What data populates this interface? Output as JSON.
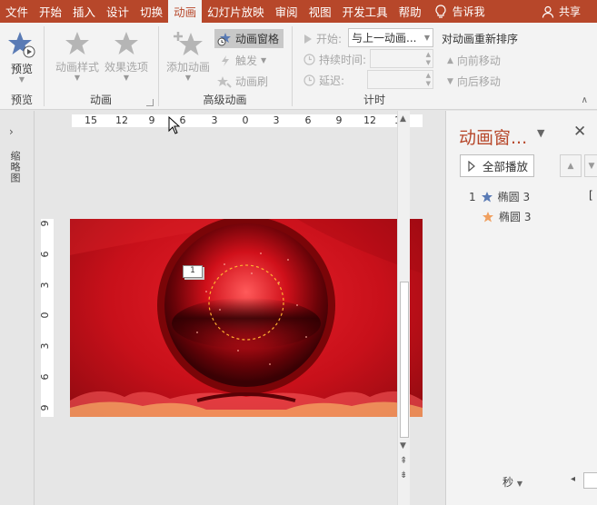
{
  "tabs": [
    "文件",
    "开始",
    "插入",
    "设计",
    "切换",
    "动画",
    "幻灯片放映",
    "审阅",
    "视图",
    "开发工具",
    "帮助"
  ],
  "active_tab_index": 5,
  "tell_me": "告诉我",
  "share": "共享",
  "ribbon": {
    "preview_group": {
      "button": "预览",
      "label": "预览"
    },
    "animation_group": {
      "styles": "动画样式",
      "effects": "效果选项",
      "label": "动画"
    },
    "advanced_group": {
      "add": "添加动画",
      "pane": "动画窗格",
      "trigger": "触发",
      "painter": "动画刷",
      "label": "高级动画"
    },
    "timing_group": {
      "start_label": "开始:",
      "start_value": "与上一动画...",
      "duration_label": "持续时间:",
      "delay_label": "延迟:",
      "reorder_label": "对动画重新排序",
      "move_earlier": "向前移动",
      "move_later": "向后移动",
      "label": "计时"
    }
  },
  "left_pane": {
    "label": "缩略图"
  },
  "ruler": {
    "h_ticks": [
      "15",
      "12",
      "9",
      "6",
      "3",
      "0",
      "3",
      "6",
      "9",
      "12",
      "15"
    ],
    "v_ticks": [
      "9",
      "6",
      "3",
      "0",
      "3",
      "6",
      "9"
    ]
  },
  "slide": {
    "tag_number": "1"
  },
  "anim_pane": {
    "title": "动画窗...",
    "play_all": "全部播放",
    "items": [
      {
        "index": "1",
        "name": "椭圆 3"
      },
      {
        "index": "",
        "name": "椭圆 3"
      }
    ],
    "footer_unit": "秒"
  },
  "colors": {
    "accent": "#b7472a",
    "star_blue": "#5a7bb5",
    "star_orange": "#f0a060"
  }
}
